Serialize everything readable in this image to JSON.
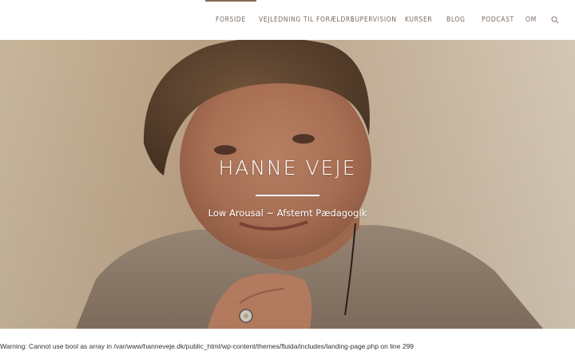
{
  "nav": {
    "items": [
      {
        "label": "FORSIDE",
        "active": true
      },
      {
        "label": "VEJLEDNING TIL FORÆLDRE"
      },
      {
        "label": "SUPERVISION"
      },
      {
        "label": "KURSER"
      },
      {
        "label": "BLOG"
      },
      {
        "label": "PODCAST"
      },
      {
        "label": "OM"
      }
    ],
    "search_icon": "search-icon",
    "active_color": "#8a6a58"
  },
  "hero": {
    "title": "HANNE VEJE",
    "subtitle": "Low Arousal ~ Afstemt Pædagogik"
  },
  "warning": {
    "text": "Warning: Cannot use bool as array in /var/www/hanneveje.dk/public_html/wp-content/themes/fluida/includes/landing-page.php on line 299"
  }
}
